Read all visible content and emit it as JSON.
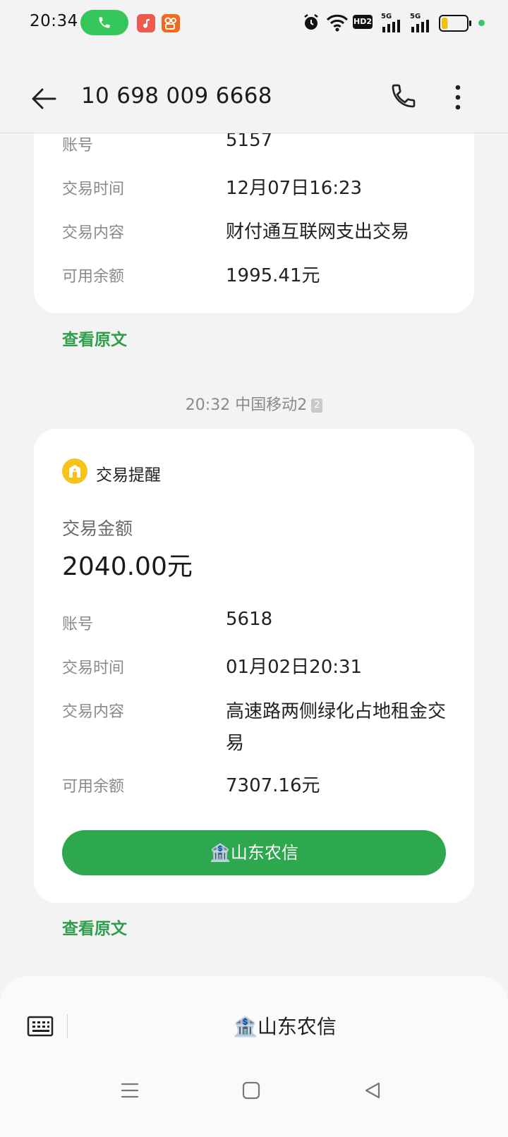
{
  "status_bar": {
    "time": "20:34",
    "network_badges": [
      "HD2",
      "5G",
      "5G"
    ],
    "icons": [
      "call-active-icon",
      "music-app-icon",
      "kuaishou-app-icon",
      "alarm-icon",
      "wifi-icon",
      "hd-icon",
      "signal-5g-icon",
      "signal-5g-icon",
      "battery-icon"
    ],
    "battery_level": 0.25
  },
  "header": {
    "title": "10 698 009 6668",
    "icons": [
      "back-arrow-icon",
      "phone-icon",
      "more-vert-icon"
    ]
  },
  "messages": [
    {
      "rows": [
        {
          "label": "账号",
          "value": "5157"
        },
        {
          "label": "交易时间",
          "value": "12月07日16:23"
        },
        {
          "label": "交易内容",
          "value": "财付通互联网支出交易"
        },
        {
          "label": "可用余额",
          "value": "1995.41元"
        }
      ],
      "view_original": "查看原文"
    },
    {
      "timestamp": "20:32 中国移动2",
      "sim_badge": "2",
      "card_title": "交易提醒",
      "amount_label": "交易金额",
      "amount": "2040.00元",
      "rows": [
        {
          "label": "账号",
          "value": "5618"
        },
        {
          "label": "交易时间",
          "value": "01月02日20:31"
        },
        {
          "label": "交易内容",
          "value": "高速路两侧绿化占地租金交易"
        },
        {
          "label": "可用余额",
          "value": "7307.16元"
        }
      ],
      "button_label": "🏦山东农信",
      "view_original": "查看原文"
    }
  ],
  "bottom_bar": {
    "menu_label": "🏦山东农信",
    "icons": [
      "keyboard-icon",
      "nav-menu-icon",
      "nav-home-icon",
      "nav-back-icon"
    ]
  },
  "colors": {
    "accent_green": "#2da84f",
    "link_green": "#2e9e4a",
    "call_pill": "#35c759",
    "bank_icon": "#f7c21a"
  }
}
